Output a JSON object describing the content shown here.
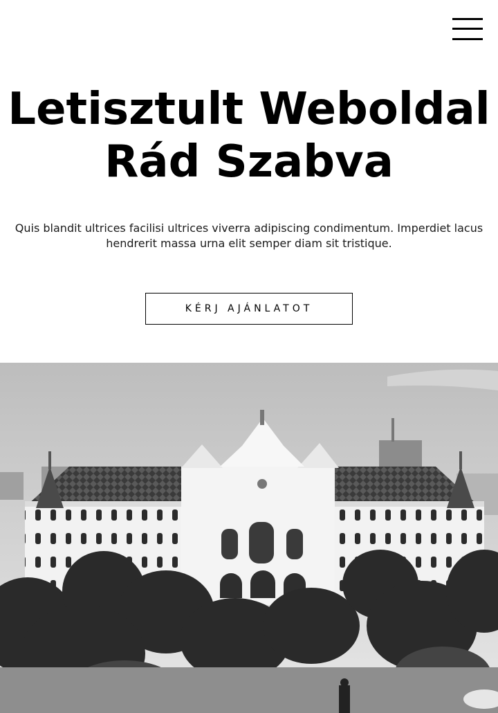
{
  "header": {
    "menu_icon": "hamburger-menu-icon"
  },
  "hero": {
    "title_line1": "Letisztult Weboldal",
    "title_line2": "Rád Szabva",
    "description": "Quis blandit ultrices facilisi ultrices viverra adipiscing condimentum. Imperdiet lacus hendrerit massa urna elit semper diam sit tristique.",
    "cta_label": "KÉRJ AJÁNLATOT"
  },
  "image": {
    "subject": "grayscale photo of a historic palace building with trees and a statue"
  }
}
